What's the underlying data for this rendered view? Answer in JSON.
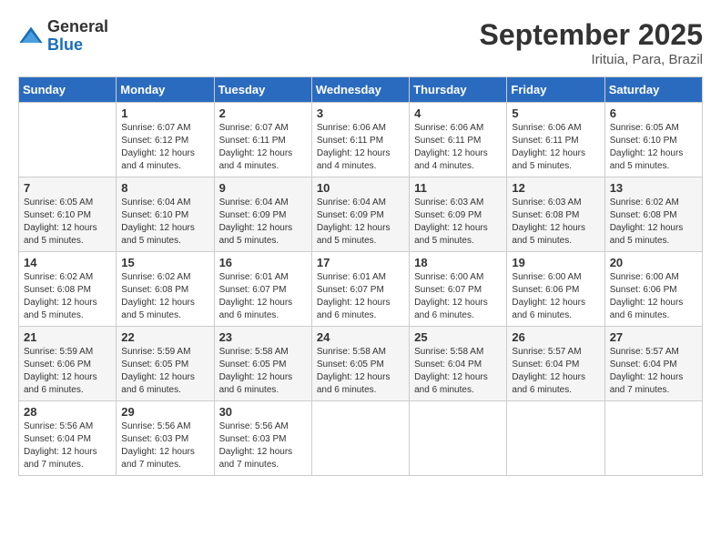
{
  "header": {
    "logo_general": "General",
    "logo_blue": "Blue",
    "month_title": "September 2025",
    "subtitle": "Irituia, Para, Brazil"
  },
  "columns": [
    "Sunday",
    "Monday",
    "Tuesday",
    "Wednesday",
    "Thursday",
    "Friday",
    "Saturday"
  ],
  "weeks": [
    [
      {
        "day": "",
        "info": ""
      },
      {
        "day": "1",
        "info": "Sunrise: 6:07 AM\nSunset: 6:12 PM\nDaylight: 12 hours\nand 4 minutes."
      },
      {
        "day": "2",
        "info": "Sunrise: 6:07 AM\nSunset: 6:11 PM\nDaylight: 12 hours\nand 4 minutes."
      },
      {
        "day": "3",
        "info": "Sunrise: 6:06 AM\nSunset: 6:11 PM\nDaylight: 12 hours\nand 4 minutes."
      },
      {
        "day": "4",
        "info": "Sunrise: 6:06 AM\nSunset: 6:11 PM\nDaylight: 12 hours\nand 4 minutes."
      },
      {
        "day": "5",
        "info": "Sunrise: 6:06 AM\nSunset: 6:11 PM\nDaylight: 12 hours\nand 5 minutes."
      },
      {
        "day": "6",
        "info": "Sunrise: 6:05 AM\nSunset: 6:10 PM\nDaylight: 12 hours\nand 5 minutes."
      }
    ],
    [
      {
        "day": "7",
        "info": "Sunrise: 6:05 AM\nSunset: 6:10 PM\nDaylight: 12 hours\nand 5 minutes."
      },
      {
        "day": "8",
        "info": "Sunrise: 6:04 AM\nSunset: 6:10 PM\nDaylight: 12 hours\nand 5 minutes."
      },
      {
        "day": "9",
        "info": "Sunrise: 6:04 AM\nSunset: 6:09 PM\nDaylight: 12 hours\nand 5 minutes."
      },
      {
        "day": "10",
        "info": "Sunrise: 6:04 AM\nSunset: 6:09 PM\nDaylight: 12 hours\nand 5 minutes."
      },
      {
        "day": "11",
        "info": "Sunrise: 6:03 AM\nSunset: 6:09 PM\nDaylight: 12 hours\nand 5 minutes."
      },
      {
        "day": "12",
        "info": "Sunrise: 6:03 AM\nSunset: 6:08 PM\nDaylight: 12 hours\nand 5 minutes."
      },
      {
        "day": "13",
        "info": "Sunrise: 6:02 AM\nSunset: 6:08 PM\nDaylight: 12 hours\nand 5 minutes."
      }
    ],
    [
      {
        "day": "14",
        "info": "Sunrise: 6:02 AM\nSunset: 6:08 PM\nDaylight: 12 hours\nand 5 minutes."
      },
      {
        "day": "15",
        "info": "Sunrise: 6:02 AM\nSunset: 6:08 PM\nDaylight: 12 hours\nand 5 minutes."
      },
      {
        "day": "16",
        "info": "Sunrise: 6:01 AM\nSunset: 6:07 PM\nDaylight: 12 hours\nand 6 minutes."
      },
      {
        "day": "17",
        "info": "Sunrise: 6:01 AM\nSunset: 6:07 PM\nDaylight: 12 hours\nand 6 minutes."
      },
      {
        "day": "18",
        "info": "Sunrise: 6:00 AM\nSunset: 6:07 PM\nDaylight: 12 hours\nand 6 minutes."
      },
      {
        "day": "19",
        "info": "Sunrise: 6:00 AM\nSunset: 6:06 PM\nDaylight: 12 hours\nand 6 minutes."
      },
      {
        "day": "20",
        "info": "Sunrise: 6:00 AM\nSunset: 6:06 PM\nDaylight: 12 hours\nand 6 minutes."
      }
    ],
    [
      {
        "day": "21",
        "info": "Sunrise: 5:59 AM\nSunset: 6:06 PM\nDaylight: 12 hours\nand 6 minutes."
      },
      {
        "day": "22",
        "info": "Sunrise: 5:59 AM\nSunset: 6:05 PM\nDaylight: 12 hours\nand 6 minutes."
      },
      {
        "day": "23",
        "info": "Sunrise: 5:58 AM\nSunset: 6:05 PM\nDaylight: 12 hours\nand 6 minutes."
      },
      {
        "day": "24",
        "info": "Sunrise: 5:58 AM\nSunset: 6:05 PM\nDaylight: 12 hours\nand 6 minutes."
      },
      {
        "day": "25",
        "info": "Sunrise: 5:58 AM\nSunset: 6:04 PM\nDaylight: 12 hours\nand 6 minutes."
      },
      {
        "day": "26",
        "info": "Sunrise: 5:57 AM\nSunset: 6:04 PM\nDaylight: 12 hours\nand 6 minutes."
      },
      {
        "day": "27",
        "info": "Sunrise: 5:57 AM\nSunset: 6:04 PM\nDaylight: 12 hours\nand 7 minutes."
      }
    ],
    [
      {
        "day": "28",
        "info": "Sunrise: 5:56 AM\nSunset: 6:04 PM\nDaylight: 12 hours\nand 7 minutes."
      },
      {
        "day": "29",
        "info": "Sunrise: 5:56 AM\nSunset: 6:03 PM\nDaylight: 12 hours\nand 7 minutes."
      },
      {
        "day": "30",
        "info": "Sunrise: 5:56 AM\nSunset: 6:03 PM\nDaylight: 12 hours\nand 7 minutes."
      },
      {
        "day": "",
        "info": ""
      },
      {
        "day": "",
        "info": ""
      },
      {
        "day": "",
        "info": ""
      },
      {
        "day": "",
        "info": ""
      }
    ]
  ]
}
